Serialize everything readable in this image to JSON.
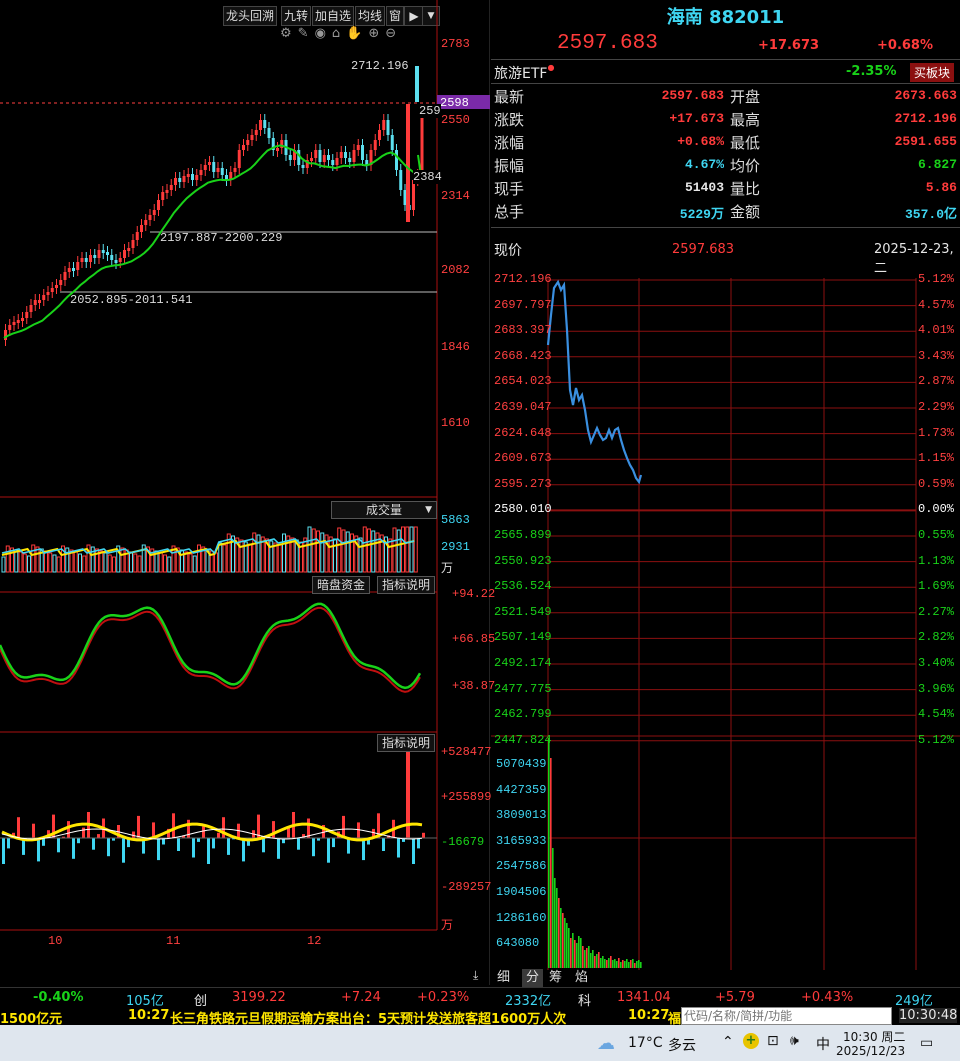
{
  "toolbar": {
    "btn_longtou": "龙头回溯",
    "btn_jiuzhuan": "九转",
    "btn_add_watch": "加自选",
    "btn_ma": "均线",
    "btn_window": "窗"
  },
  "kline": {
    "price_labels": [
      "2783",
      "2550",
      "2314",
      "2082",
      "1846",
      "1610"
    ],
    "current_tag": "2598",
    "cut_label_1": "259",
    "cut_label_2": "2384",
    "high_annot": "2712.196",
    "range_1": "2197.887-2200.229",
    "range_2": "2052.895-2011.541"
  },
  "volume": {
    "title": "成交量",
    "labels": [
      "5863",
      "2931",
      "万"
    ]
  },
  "ind1": {
    "btn1": "暗盘资金",
    "btn2": "指标说明",
    "labels": [
      "+94.22",
      "+66.85",
      "+38.87"
    ]
  },
  "ind2": {
    "btn": "指标说明",
    "labels": [
      "+528477",
      "+255899",
      "-16679",
      "-289257",
      "万"
    ]
  },
  "xaxis": [
    "10",
    "11",
    "12"
  ],
  "quote": {
    "name": "海南 882011",
    "price": "2597.683",
    "change": "+17.673",
    "pct": "+0.68%",
    "etf_label": "旅游ETF",
    "etf_pct": "-2.35%",
    "buy_block": "买板块",
    "rows": [
      {
        "l1": "最新",
        "v1": "2597.683",
        "c1": "red",
        "l2": "开盘",
        "v2": "2673.663",
        "c2": "red"
      },
      {
        "l1": "涨跌",
        "v1": "+17.673",
        "c1": "red",
        "l2": "最高",
        "v2": "2712.196",
        "c2": "red"
      },
      {
        "l1": "涨幅",
        "v1": "+0.68%",
        "c1": "red",
        "l2": "最低",
        "v2": "2591.655",
        "c2": "red"
      },
      {
        "l1": "振幅",
        "v1": "4.67%",
        "c1": "cyan",
        "l2": "均价",
        "v2": "6.827",
        "c2": "green"
      },
      {
        "l1": "现手",
        "v1": "51403",
        "c1": "white",
        "l2": "量比",
        "v2": "5.86",
        "c2": "red"
      },
      {
        "l1": "总手",
        "v1": "5229万",
        "c1": "cyan",
        "l2": "金额",
        "v2": "357.0亿",
        "c2": "cyan"
      }
    ],
    "now_label": "现价",
    "now_val": "2597.683",
    "date": "2025-12-23,二"
  },
  "intraday": {
    "left_labels": [
      "2712.196",
      "2697.797",
      "2683.397",
      "2668.423",
      "2654.023",
      "2639.047",
      "2624.648",
      "2609.673",
      "2595.273",
      "2580.010",
      "2565.899",
      "2550.923",
      "2536.524",
      "2521.549",
      "2507.149",
      "2492.174",
      "2477.775",
      "2462.799",
      "2447.824"
    ],
    "right_labels": [
      "5.12%",
      "4.57%",
      "4.01%",
      "3.43%",
      "2.87%",
      "2.29%",
      "1.73%",
      "1.15%",
      "0.59%",
      "0.00%",
      "0.55%",
      "1.13%",
      "1.69%",
      "2.27%",
      "2.82%",
      "3.40%",
      "3.96%",
      "4.54%",
      "5.12%"
    ],
    "vol_labels": [
      "5070439",
      "4427359",
      "3809013",
      "3165933",
      "2547586",
      "1904506",
      "1286160",
      "643080"
    ]
  },
  "tabs": [
    "细",
    "分",
    "筹",
    "焰"
  ],
  "status1": {
    "a": "-0.40%",
    "b": "105亿",
    "c": "创",
    "d": "3199.22",
    "e": "+7.24",
    "f": "+0.23%",
    "g": "2332亿",
    "h": "科",
    "i": "1341.04",
    "j": "+5.79",
    "k": "+0.43%",
    "l": "249亿"
  },
  "status2": {
    "left": "1500亿元",
    "time1": "10:27",
    "news": "长三角铁路元旦假期运输方案出台：5天预计发送旅客超1600万人次",
    "time2": "10:27",
    "flag": "福",
    "search_placeholder": "代码/名称/简拼/功能",
    "clock": "10:30:48"
  },
  "taskbar": {
    "temp": "17°C",
    "weather": "多云",
    "ime": "中",
    "time": "10:30 周二",
    "date": "2025/12/23"
  }
}
